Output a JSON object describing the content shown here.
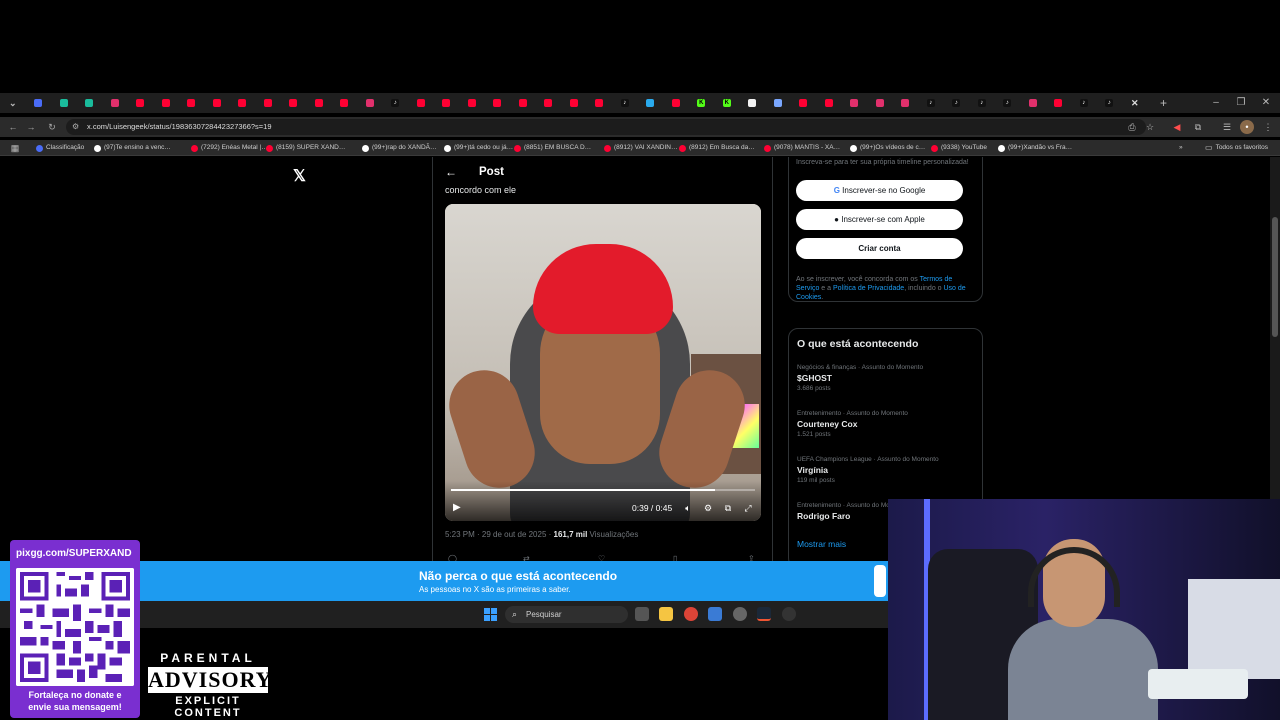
{
  "browser": {
    "url": "x.com/Luisengeek/status/1983630728442327366?s=19",
    "bookmarks": [
      {
        "label": "Classificação",
        "color": "#4a6cf7"
      },
      {
        "label": "(97)Te ensino a venc…",
        "color": "#ffffff"
      },
      {
        "label": "(7292) Enéas Metal |…",
        "color": "#ff0033"
      },
      {
        "label": "(8159) SUPER XAND…",
        "color": "#ff0033"
      },
      {
        "label": "(99+)rap do XANDÃ…",
        "color": "#ffffff"
      },
      {
        "label": "(99+)tá cedo ou já…",
        "color": "#ffffff"
      },
      {
        "label": "(8851) EM BUSCA D…",
        "color": "#ff0033"
      },
      {
        "label": "(8912) VAI XANDIN…",
        "color": "#ff0033"
      },
      {
        "label": "(8912) Em Busca da…",
        "color": "#ff0033"
      },
      {
        "label": "(9078) MANTIS - XA…",
        "color": "#ff0033"
      },
      {
        "label": "(99+)Os vídeos de c…",
        "color": "#ffffff"
      },
      {
        "label": "(9338) YouTube",
        "color": "#ff0033"
      },
      {
        "label": "(99+)Xandão vs Fra…",
        "color": "#ffffff"
      }
    ],
    "all_bookmarks": "Todos os favoritos",
    "tab_icons": [
      "chevron",
      "ai",
      "code",
      "code",
      "instagram",
      "youtube",
      "youtube",
      "youtube",
      "youtube",
      "youtube",
      "youtube",
      "youtube",
      "youtube",
      "youtube",
      "instagram",
      "tiktok",
      "youtube",
      "youtube",
      "youtube",
      "youtube",
      "youtube",
      "youtube",
      "youtube",
      "youtube",
      "tiktok",
      "telegram",
      "youtube",
      "kick",
      "kick",
      "chrome",
      "generic",
      "youtube",
      "youtube",
      "instagram",
      "instagram",
      "instagram",
      "tiktok",
      "tiktok",
      "tiktok",
      "tiktok",
      "instagram",
      "youtube",
      "tiktok",
      "tiktok",
      "close"
    ],
    "new_tab": "+"
  },
  "post": {
    "header_title": "Post",
    "text": "concordo com ele",
    "video": {
      "progress": 0.867,
      "time": "0:39 / 0:45"
    },
    "meta_time": "5:23 PM · 29 de out de 2025 · ",
    "views_count": "161,7 mil",
    "views_label": " Visualizações"
  },
  "sidebar": {
    "signup_intro": "Inscreva-se para ter sua própria timeline personalizada!",
    "google_button": "Inscrever-se no Google",
    "apple_button": "Inscrever-se com Apple",
    "create_account": "Criar conta",
    "legal": {
      "prefix": "Ao se inscrever, você concorda com os ",
      "terms": "Termos de Serviço",
      "mid1": " e a ",
      "privacy": "Política de Privacidade",
      "mid2": ", incluindo o ",
      "cookies": "Uso de Cookies",
      "suffix": "."
    },
    "trends_title": "O que está acontecendo",
    "trends": [
      {
        "category": "Negócios & finanças · Assunto do Momento",
        "name": "$GHOST",
        "count": "3.686 posts"
      },
      {
        "category": "Entretenimento · Assunto do Momento",
        "name": "Courteney Cox",
        "count": "1.521 posts"
      },
      {
        "category": "UEFA Champions League · Assunto do Momento",
        "name": "Virgínia",
        "count": "119 mil posts"
      },
      {
        "category": "Entretenimento · Assunto do Momento",
        "name": "Rodrigo Faro",
        "count": ""
      }
    ],
    "show_more": "Mostrar mais"
  },
  "banner": {
    "headline": "Não perca o que está acontecendo",
    "subline": "As pessoas no X são as primeiras a saber."
  },
  "taskbar": {
    "search_placeholder": "Pesquisar"
  },
  "overlay": {
    "donate_handle": "pixgg.com/SUPERXAND",
    "donate_cta_line1": "Fortaleça no donate e",
    "donate_cta_line2": "envie sua mensagem!",
    "advisory_top": "PARENTAL",
    "advisory_mid": "ADVISORY",
    "advisory_bottom": "EXPLICIT CONTENT"
  },
  "colors": {
    "x_blue": "#1d9bf0",
    "youtube": "#ff0033",
    "instagram": "#e1306c",
    "kick": "#53fc18",
    "telegram": "#2aabee",
    "qr_panel": "#7a2fd0"
  }
}
